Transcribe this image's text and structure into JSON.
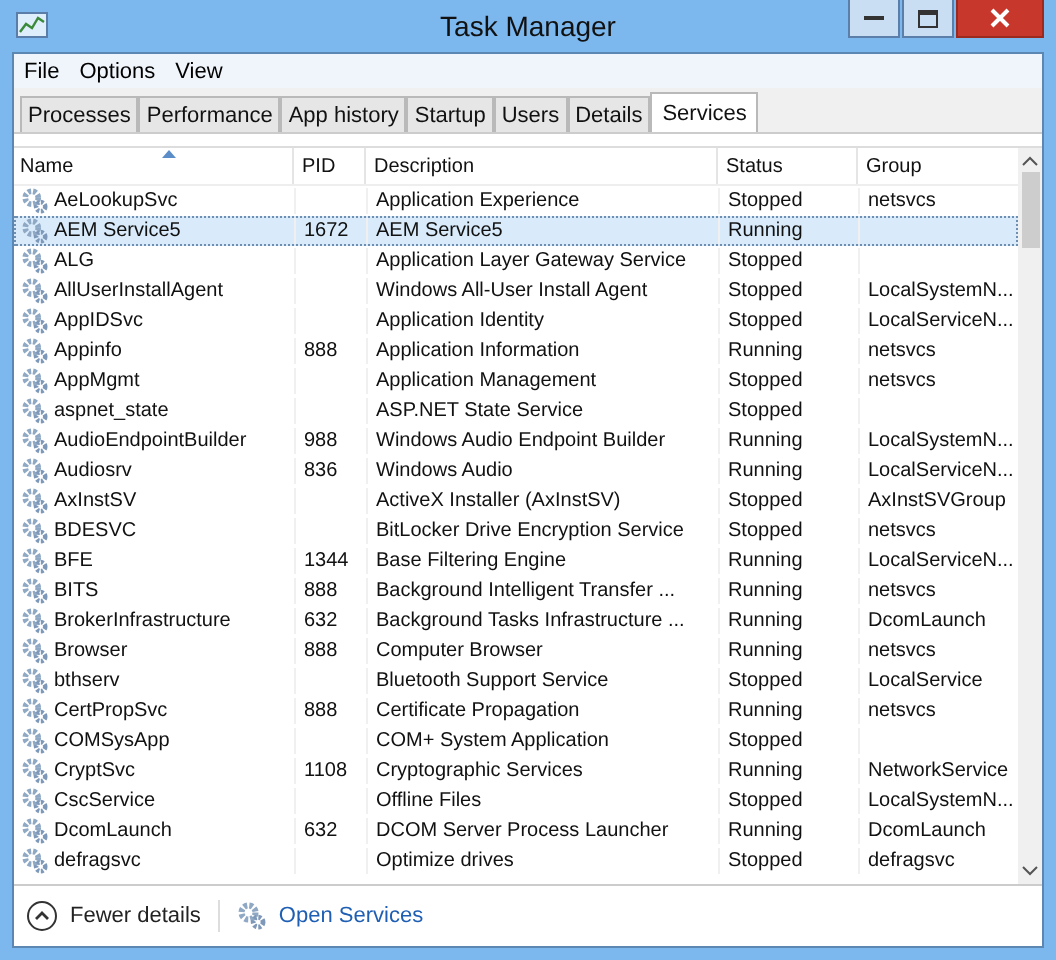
{
  "window": {
    "title": "Task Manager"
  },
  "menu": [
    "File",
    "Options",
    "View"
  ],
  "tabs": [
    {
      "label": "Processes",
      "selected": false
    },
    {
      "label": "Performance",
      "selected": false
    },
    {
      "label": "App history",
      "selected": false
    },
    {
      "label": "Startup",
      "selected": false
    },
    {
      "label": "Users",
      "selected": false
    },
    {
      "label": "Details",
      "selected": false
    },
    {
      "label": "Services",
      "selected": true
    }
  ],
  "table": {
    "columns": [
      "Name",
      "PID",
      "Description",
      "Status",
      "Group"
    ],
    "rows": [
      {
        "name": "AeLookupSvc",
        "description": "Application Experience",
        "status": "Stopped",
        "group": "netsvcs",
        "selected": false
      },
      {
        "name": "AEM Service5",
        "pid": "1672",
        "description": "AEM Service5",
        "status": "Running",
        "selected": true
      },
      {
        "name": "ALG",
        "description": "Application Layer Gateway Service",
        "status": "Stopped",
        "selected": false
      },
      {
        "name": "AllUserInstallAgent",
        "description": "Windows All-User Install Agent",
        "status": "Stopped",
        "group": "LocalSystemN...",
        "selected": false
      },
      {
        "name": "AppIDSvc",
        "description": "Application Identity",
        "status": "Stopped",
        "group": "LocalServiceN...",
        "selected": false
      },
      {
        "name": "Appinfo",
        "pid": "888",
        "description": "Application Information",
        "status": "Running",
        "group": "netsvcs",
        "selected": false
      },
      {
        "name": "AppMgmt",
        "description": "Application Management",
        "status": "Stopped",
        "group": "netsvcs",
        "selected": false
      },
      {
        "name": "aspnet_state",
        "description": "ASP.NET State Service",
        "status": "Stopped",
        "selected": false
      },
      {
        "name": "AudioEndpointBuilder",
        "pid": "988",
        "description": "Windows Audio Endpoint Builder",
        "status": "Running",
        "group": "LocalSystemN...",
        "selected": false
      },
      {
        "name": "Audiosrv",
        "pid": "836",
        "description": "Windows Audio",
        "status": "Running",
        "group": "LocalServiceN...",
        "selected": false
      },
      {
        "name": "AxInstSV",
        "description": "ActiveX Installer (AxInstSV)",
        "status": "Stopped",
        "group": "AxInstSVGroup",
        "selected": false
      },
      {
        "name": "BDESVC",
        "description": "BitLocker Drive Encryption Service",
        "status": "Stopped",
        "group": "netsvcs",
        "selected": false
      },
      {
        "name": "BFE",
        "pid": "1344",
        "description": "Base Filtering Engine",
        "status": "Running",
        "group": "LocalServiceN...",
        "selected": false
      },
      {
        "name": "BITS",
        "pid": "888",
        "description": "Background Intelligent Transfer ...",
        "status": "Running",
        "group": "netsvcs",
        "selected": false
      },
      {
        "name": "BrokerInfrastructure",
        "pid": "632",
        "description": "Background Tasks Infrastructure ...",
        "status": "Running",
        "group": "DcomLaunch",
        "selected": false
      },
      {
        "name": "Browser",
        "pid": "888",
        "description": "Computer Browser",
        "status": "Running",
        "group": "netsvcs",
        "selected": false
      },
      {
        "name": "bthserv",
        "description": "Bluetooth Support Service",
        "status": "Stopped",
        "group": "LocalService",
        "selected": false
      },
      {
        "name": "CertPropSvc",
        "pid": "888",
        "description": "Certificate Propagation",
        "status": "Running",
        "group": "netsvcs",
        "selected": false
      },
      {
        "name": "COMSysApp",
        "description": "COM+ System Application",
        "status": "Stopped",
        "selected": false
      },
      {
        "name": "CryptSvc",
        "pid": "1108",
        "description": "Cryptographic Services",
        "status": "Running",
        "group": "NetworkService",
        "selected": false
      },
      {
        "name": "CscService",
        "description": "Offline Files",
        "status": "Stopped",
        "group": "LocalSystemN...",
        "selected": false
      },
      {
        "name": "DcomLaunch",
        "pid": "632",
        "description": "DCOM Server Process Launcher",
        "status": "Running",
        "group": "DcomLaunch",
        "selected": false
      },
      {
        "name": "defragsvc",
        "description": "Optimize drives",
        "status": "Stopped",
        "group": "defragsvc",
        "selected": false
      }
    ]
  },
  "footer": {
    "fewer_details": "Fewer details",
    "open_services": "Open Services"
  }
}
